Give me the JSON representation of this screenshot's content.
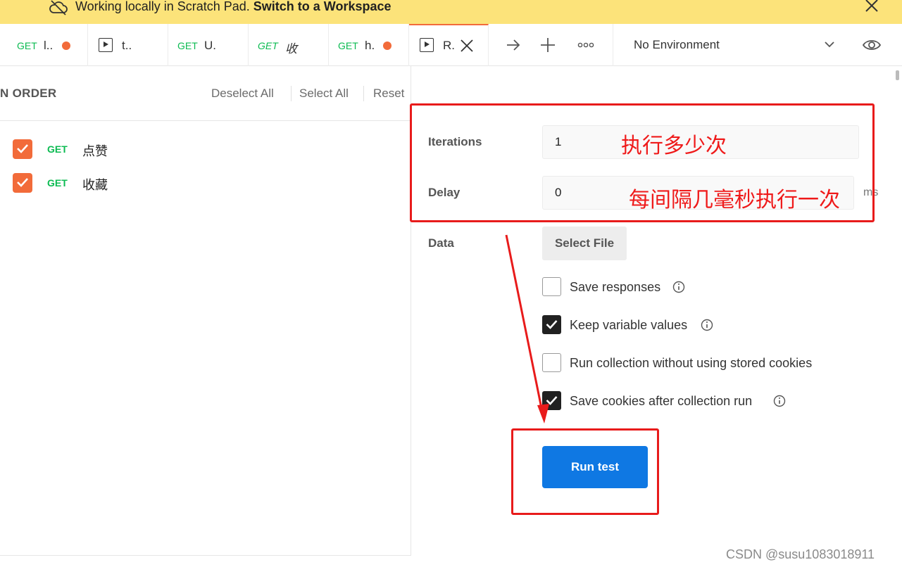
{
  "banner": {
    "message": "Working locally in Scratch Pad.",
    "link": "Switch to a Workspace",
    "bg": "#fce37a"
  },
  "tabs": [
    {
      "method": "GET",
      "name": "l..",
      "unsaved": true
    },
    {
      "icon": "runner-icon",
      "name": "t.."
    },
    {
      "method": "GET",
      "name": "U."
    },
    {
      "method": "GET",
      "name": "收"
    },
    {
      "method": "GET",
      "name": "h.",
      "unsaved": true
    },
    {
      "icon": "runner-icon",
      "name": "R.",
      "active": true
    }
  ],
  "environment": {
    "selected": "No Environment"
  },
  "run_order": {
    "title": "N ORDER",
    "deselect_all": "Deselect All",
    "select_all": "Select All",
    "reset": "Reset",
    "requests": [
      {
        "method": "GET",
        "name": "点赞",
        "checked": true
      },
      {
        "method": "GET",
        "name": "收藏",
        "checked": true
      }
    ]
  },
  "runner": {
    "iterations_label": "Iterations",
    "iterations_value": "1",
    "delay_label": "Delay",
    "delay_value": "0",
    "delay_unit": "ms",
    "data_label": "Data",
    "select_file": "Select File",
    "options": [
      {
        "label": "Save responses",
        "checked": false,
        "info": true
      },
      {
        "label": "Keep variable values",
        "checked": true,
        "info": true
      },
      {
        "label": "Run collection without using stored cookies",
        "checked": false,
        "info": false
      },
      {
        "label": "Save cookies after collection run",
        "checked": true,
        "info": true
      }
    ],
    "run_button": "Run test"
  },
  "annotations": {
    "iterations_note": "执行多少次",
    "delay_note": "每间隔几毫秒执行一次",
    "color": "#e81b1b"
  },
  "watermark": "CSDN @susu1083018911",
  "colors": {
    "method_get": "#0cbb52",
    "accent": "#f26b3a",
    "primary": "#0f78e3"
  }
}
